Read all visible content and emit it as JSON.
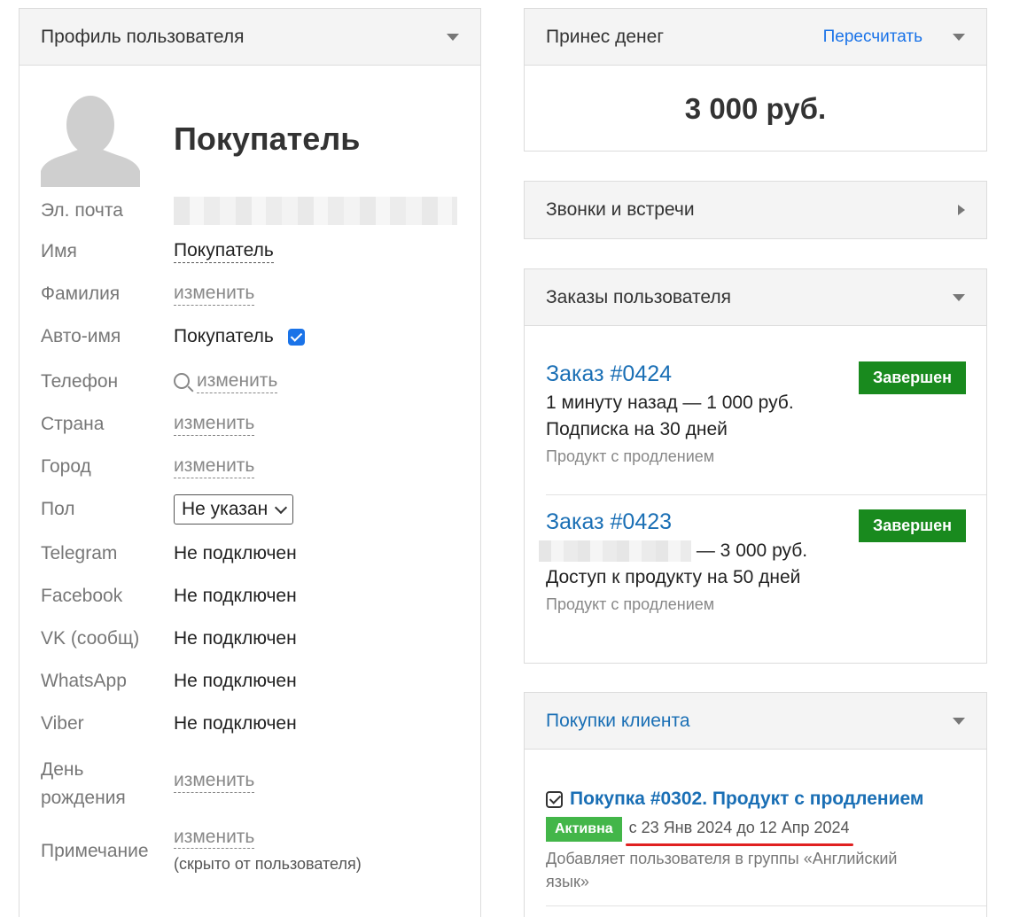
{
  "profile": {
    "header_title": "Профиль пользователя",
    "name": "Покупатель",
    "fields": {
      "email_label": "Эл. почта",
      "first_name_label": "Имя",
      "first_name_value": "Покупатель",
      "last_name_label": "Фамилия",
      "last_name_value": "изменить",
      "auto_name_label": "Авто-имя",
      "auto_name_value": "Покупатель",
      "phone_label": "Телефон",
      "phone_value": "изменить",
      "country_label": "Страна",
      "country_value": "изменить",
      "city_label": "Город",
      "city_value": "изменить",
      "gender_label": "Пол",
      "gender_value": "Не указан",
      "telegram_label": "Telegram",
      "telegram_value": "Не подключен",
      "facebook_label": "Facebook",
      "facebook_value": "Не подключен",
      "vk_label": "VK (сообщ)",
      "vk_value": "Не подключен",
      "whatsapp_label": "WhatsApp",
      "whatsapp_value": "Не подключен",
      "viber_label": "Viber",
      "viber_value": "Не подключен",
      "birthday_label_1": "День",
      "birthday_label_2": "рождения",
      "birthday_value": "изменить",
      "note_label": "Примечание",
      "note_value": "изменить",
      "note_hint": "(скрыто от пользователя)"
    }
  },
  "money": {
    "header_title": "Принес денег",
    "recalc_label": "Пересчитать",
    "amount": "3 000 руб."
  },
  "calls": {
    "header_title": "Звонки и встречи"
  },
  "orders": {
    "header_title": "Заказы пользователя",
    "items": [
      {
        "title": "Заказ #0424",
        "status": "Завершен",
        "line1": "1 минуту назад — 1 000 руб.",
        "line2": "Подписка на 30 дней",
        "sub": "Продукт с продлением"
      },
      {
        "title": "Заказ #0423",
        "status": "Завершен",
        "line1": "— 3 000 руб.",
        "line2": "Доступ к продукту на 50 дней",
        "sub": "Продукт с продлением"
      }
    ]
  },
  "purchases": {
    "header_title": "Покупки клиента",
    "item": {
      "title": "Покупка #0302. Продукт с продлением",
      "status": "Активна",
      "dates": "с 23 Янв 2024 до 12 Апр 2024",
      "desc": "Добавляет пользователя в группы «Английский язык»"
    }
  },
  "colors": {
    "link": "#1a6fb5",
    "badge_done": "#198a1e",
    "badge_active": "#43b649",
    "highlight": "#e02020"
  }
}
